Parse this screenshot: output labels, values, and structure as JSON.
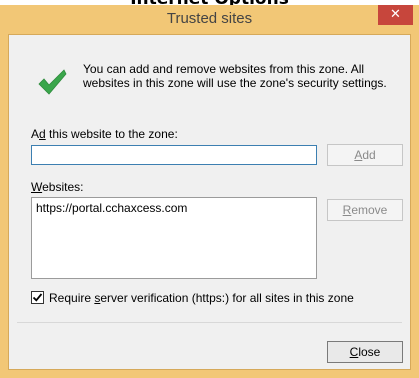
{
  "heading": {
    "text": "Internet Options"
  },
  "dialog": {
    "title": "Trusted sites",
    "close_glyph": "✕",
    "info_icon": "green-checkmark-icon",
    "info_text": "You can add and remove websites from this zone. All websites in this zone will use the zone's security settings."
  },
  "add_section": {
    "label_accel": "d",
    "label_rest": " this website to the zone:",
    "label_prefix": "A",
    "input_value": "",
    "add_button_accel": "A",
    "add_button_rest": "dd"
  },
  "websites_section": {
    "label_accel": "W",
    "label_rest": "ebsites:",
    "items": [
      "https://portal.cchaxcess.com"
    ],
    "remove_button_accel": "R",
    "remove_button_rest": "emove"
  },
  "verification": {
    "checked": true,
    "label_before": "Require ",
    "label_accel": "s",
    "label_after": "erver verification (https:) for all sites in this zone"
  },
  "footer": {
    "close_button_accel": "C",
    "close_button_rest": "lose"
  },
  "colors": {
    "window_frame": "#f2c776",
    "close_button": "#c7463c",
    "input_border": "#3c7fb1",
    "check_green": "#3aa64b"
  }
}
